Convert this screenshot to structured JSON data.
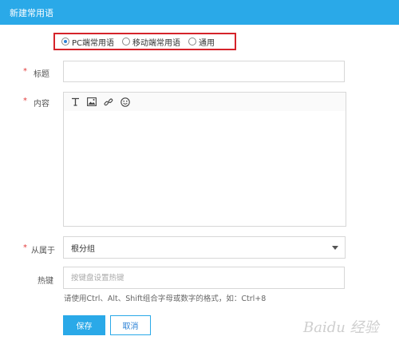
{
  "window": {
    "title": "新建常用语"
  },
  "scope_radios": [
    {
      "label": "PC端常用语",
      "checked": true
    },
    {
      "label": "移动端常用语",
      "checked": false
    },
    {
      "label": "通用",
      "checked": false
    }
  ],
  "form": {
    "title_label": "标题",
    "title_value": "",
    "content_label": "内容",
    "toolbar_icons": [
      "text-format-icon",
      "image-icon",
      "link-icon",
      "emoji-icon"
    ],
    "group_label": "从属于",
    "group_value": "根分组",
    "hotkey_label": "热键",
    "hotkey_placeholder": "按键盘设置热键",
    "hotkey_hint": "请使用Ctrl、Alt、Shift组合字母或数字的格式，如：Ctrl+8",
    "required_mark": "*"
  },
  "buttons": {
    "save": "保存",
    "cancel": "取消"
  },
  "watermark": {
    "text": "Baidu 经验"
  },
  "colors": {
    "accent": "#2aa9e8",
    "required": "#e23a3a",
    "highlight_box": "#d5232a"
  }
}
